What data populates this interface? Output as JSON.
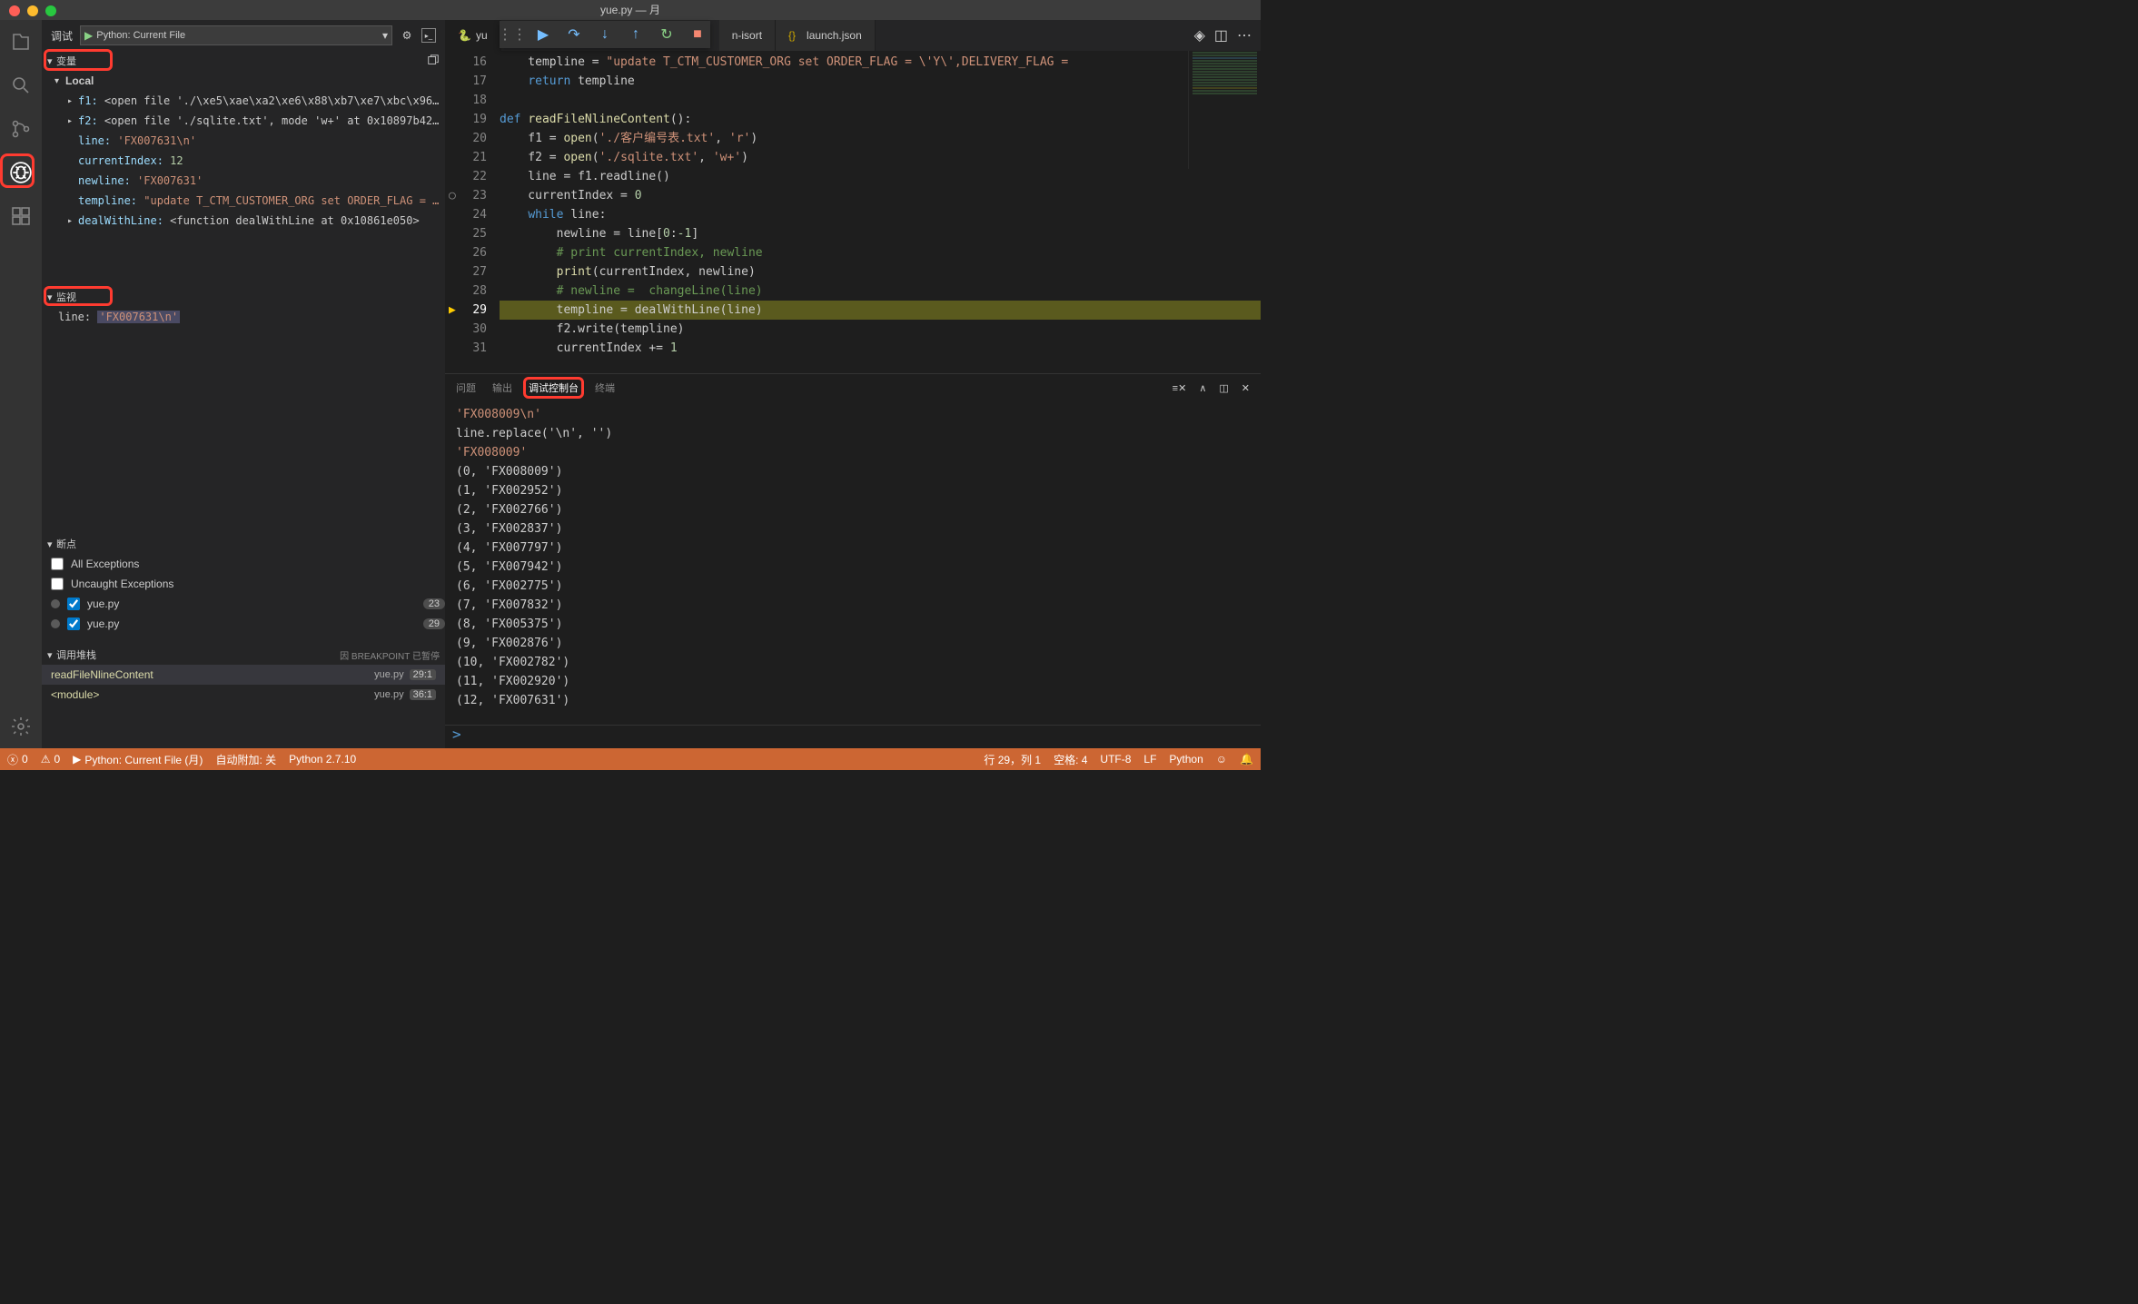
{
  "title": "yue.py — 月",
  "debug_header": {
    "title": "调试",
    "config": "Python: Current File"
  },
  "sections": {
    "vars": "变量",
    "local": "Local",
    "watch": "监视",
    "breakpoints": "断点",
    "callstack": "调用堆栈",
    "cs_status": "因 BREAKPOINT 已暂停"
  },
  "variables": {
    "f1": {
      "name": "f1:",
      "val": "<open file './\\xe5\\xae\\xa2\\xe6\\x88\\xb7\\xe7\\xbc\\x96…"
    },
    "f2": {
      "name": "f2:",
      "val": "<open file './sqlite.txt', mode 'w+' at 0x10897b42…"
    },
    "line": {
      "name": "line:",
      "val": "'FX007631\\n'"
    },
    "currentIndex": {
      "name": "currentIndex:",
      "val": "12"
    },
    "newline": {
      "name": "newline:",
      "val": "'FX007631'"
    },
    "templine": {
      "name": "templine:",
      "val": "\"update T_CTM_CUSTOMER_ORG set ORDER_FLAG = …"
    },
    "dealWithLine": {
      "name": "dealWithLine:",
      "val": "<function dealWithLine at 0x10861e050>"
    }
  },
  "watch": {
    "0": {
      "name": "line:",
      "val": "'FX007631\\n'"
    }
  },
  "breakpoints": {
    "all": "All Exceptions",
    "uncaught": "Uncaught Exceptions",
    "bp1": {
      "file": "yue.py",
      "line": "23"
    },
    "bp2": {
      "file": "yue.py",
      "line": "29"
    }
  },
  "callstack": {
    "0": {
      "fn": "readFileNlineContent",
      "file": "yue.py",
      "pos": "29:1"
    },
    "1": {
      "fn": "<module>",
      "file": "yue.py",
      "pos": "36:1"
    }
  },
  "tabs": {
    "0": "yu",
    "1": "n-isort",
    "2": "launch.json"
  },
  "panel_tabs": {
    "0": "问题",
    "1": "输出",
    "2": "调试控制台",
    "3": "终端"
  },
  "console": {
    "0": "'FX008009\\n'",
    "1": "line.replace('\\n', '')",
    "2": "'FX008009'",
    "3": "(0, 'FX008009')",
    "4": "(1, 'FX002952')",
    "5": "(2, 'FX002766')",
    "6": "(3, 'FX002837')",
    "7": "(4, 'FX007797')",
    "8": "(5, 'FX007942')",
    "9": "(6, 'FX002775')",
    "10": "(7, 'FX007832')",
    "11": "(8, 'FX005375')",
    "12": "(9, 'FX002876')",
    "13": "(10, 'FX002782')",
    "14": "(11, 'FX002920')",
    "15": "(12, 'FX007631')"
  },
  "status": {
    "errors": "0",
    "warnings": "0",
    "run": "Python: Current File (月)",
    "attach": "自动附加: 关",
    "pyver": "Python 2.7.10",
    "pos": "行 29，列 1",
    "spaces": "空格: 4",
    "enc": "UTF-8",
    "eol": "LF",
    "lang": "Python"
  },
  "gutter": {
    "0": "16",
    "1": "17",
    "2": "18",
    "3": "19",
    "4": "20",
    "5": "21",
    "6": "22",
    "7": "23",
    "8": "24",
    "9": "25",
    "10": "26",
    "11": "27",
    "12": "28",
    "13": "29",
    "14": "30",
    "15": "31"
  },
  "panel_input": ">"
}
